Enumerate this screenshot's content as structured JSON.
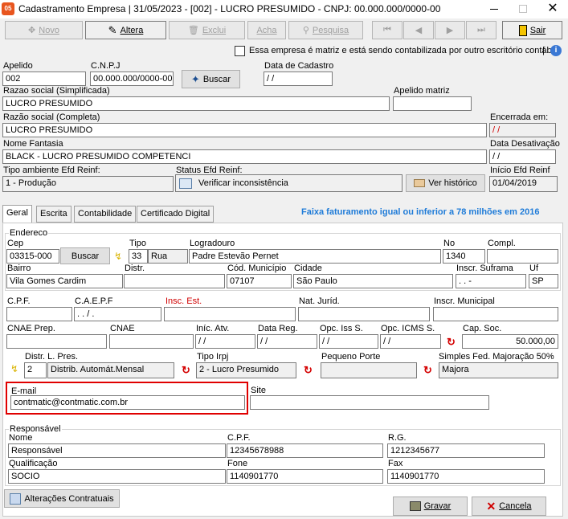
{
  "window": {
    "title": "Cadastramento Empresa | 31/05/2023 - [002] - LUCRO PRESUMIDO - CNPJ: 00.000.000/0000-00",
    "icon_text": "05"
  },
  "toolbar": {
    "novo": "Novo",
    "altera": "Altera",
    "exclui": "Exclui",
    "acha": "Acha",
    "pesquisa": "Pesquisa",
    "sair": "Sair"
  },
  "notice": "Essa empresa é matriz e está sendo contabilizada por outro escritório contábil",
  "header": {
    "apelido_label": "Apelido",
    "apelido": "002",
    "cnpj_label": "C.N.P.J",
    "cnpj": "00.000.000/0000-00",
    "buscar": "Buscar",
    "data_cad_label": "Data de Cadastro",
    "data_cad": " / /",
    "razao_simpl_label": "Razao social (Simplificada)",
    "razao_simpl": "LUCRO PRESUMIDO",
    "apelido_matriz_label": "Apelido matriz",
    "apelido_matriz": "",
    "razao_comp_label": "Razão social (Completa)",
    "razao_comp": "LUCRO PRESUMIDO",
    "encerrada_label": "Encerrada em:",
    "encerrada": " / /",
    "fantasia_label": "Nome Fantasia",
    "fantasia": "BLACK - LUCRO PRESUMIDO COMPETENCI",
    "desativ_label": "Data Desativação",
    "desativ": " / /",
    "tipo_amb_label": "Tipo ambiente Efd Reinf:",
    "tipo_amb": "1 - Produção",
    "status_label": "Status Efd Reinf:",
    "status": "Verificar inconsistência",
    "historico": "Ver histórico",
    "inicio_label": "Início Efd Reinf",
    "inicio": "01/04/2019"
  },
  "tabs": [
    "Geral",
    "Escrita",
    "Contabilidade",
    "Certificado Digital"
  ],
  "faixa": "Faixa faturamento igual ou inferior a 78 milhões em 2016",
  "endereco": {
    "group": "Endereco",
    "cep_label": "Cep",
    "cep": "03315-000",
    "buscar": "Buscar",
    "tipo_label": "Tipo",
    "tipo_code": "33",
    "tipo": "Rua",
    "logr_label": "Logradouro",
    "logr": "Padre Estevão Pernet",
    "no_label": "No",
    "no": "1340",
    "compl_label": "Compl.",
    "compl": "",
    "bairro_label": "Bairro",
    "bairro": "Vila Gomes Cardim",
    "distr_label": "Distr.",
    "distr": "",
    "codmun_label": "Cód. Município",
    "codmun": "07107",
    "cidade_label": "Cidade",
    "cidade": "São Paulo",
    "suframa_label": "Inscr. Suframa",
    "suframa": " .  .  -",
    "uf_label": "Uf",
    "uf": "SP"
  },
  "fiscal": {
    "cpf_label": "C.P.F.",
    "cpf": "",
    "caepf_label": "C.A.E.P.F",
    "caepf": " .  .  /  .",
    "insc_est_label": "Insc. Est.",
    "insc_est": "",
    "nat_label": "Nat. Juríd.",
    "nat": "",
    "insc_mun_label": "Inscr. Municipal",
    "insc_mun": "",
    "cnae_prep_label": "CNAE Prep.",
    "cnae_prep": "",
    "cnae_label": "CNAE",
    "cnae": "",
    "inic_label": "Iníc. Atv.",
    "inic": " / /",
    "datareg_label": "Data Reg.",
    "datareg": " / /",
    "opciss_label": "Opc. Iss S.",
    "opciss": " / /",
    "opcicms_label": "Opc. ICMS S.",
    "opcicms": " / /",
    "capsoc_label": "Cap. Soc.",
    "capsoc": "50.000,00",
    "distr_label": "Distr. L. Pres.",
    "distr_code": "2",
    "distr": "Distrib. Automát.Mensal",
    "irpj_label": "Tipo Irpj",
    "irpj": "2 - Lucro Presumido",
    "porte_label": "Pequeno Porte",
    "porte": "",
    "simples_label": "Simples Fed. Majoração 50%",
    "simples": "Majora"
  },
  "contato": {
    "email_label": "E-mail",
    "email": "contmatic@contmatic.com.br",
    "site_label": "Site",
    "site": ""
  },
  "responsavel": {
    "group": "Responsável",
    "nome_label": "Nome",
    "nome": "Responsável",
    "cpf_label": "C.P.F.",
    "cpf": "12345678988",
    "rg_label": "R.G.",
    "rg": "1212345677",
    "qual_label": "Qualificação",
    "qual": "SOCIO",
    "fone_label": "Fone",
    "fone": "1140901770",
    "fax_label": "Fax",
    "fax": "1140901770"
  },
  "footer": {
    "alteracoes": "Alterações Contratuais",
    "gravar": "Gravar",
    "cancela": "Cancela"
  },
  "colors": {
    "accent": "#0078d7",
    "highlight": "#e00000",
    "faixa": "#1e7bd8"
  }
}
